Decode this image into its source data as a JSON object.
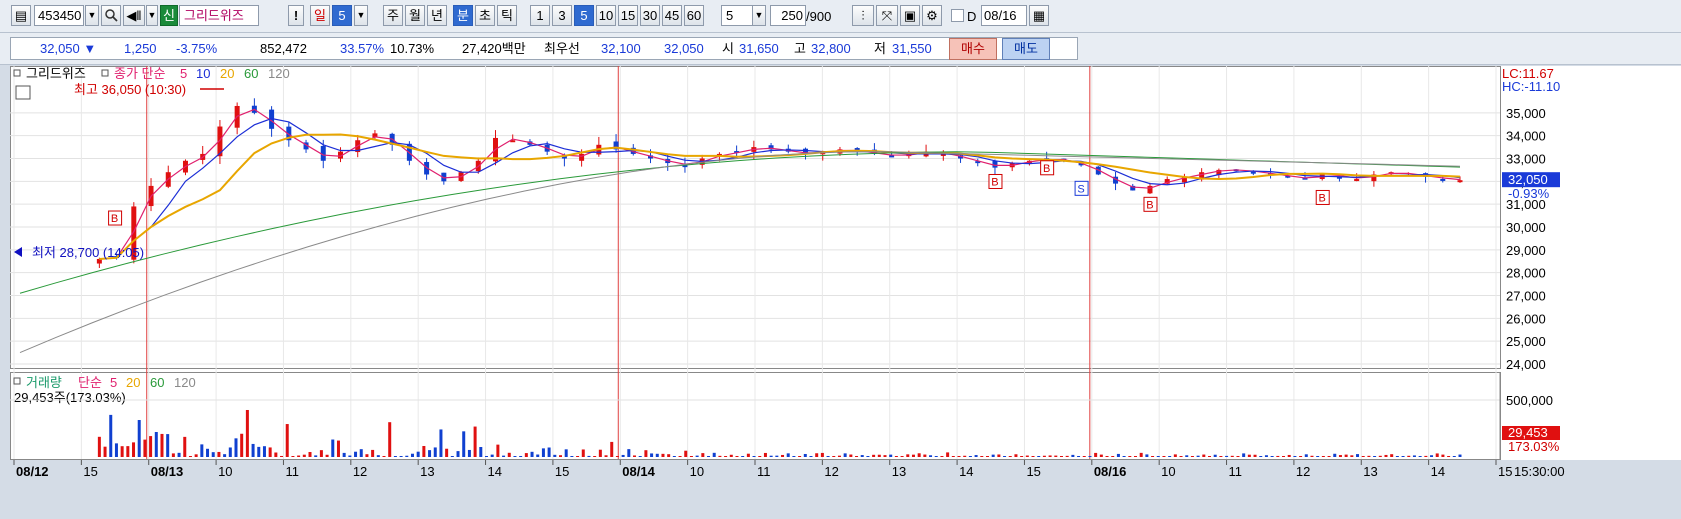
{
  "toolbar": {
    "code": "453450",
    "badge": "신",
    "name": "그리드위즈",
    "alert": "!",
    "day": "일",
    "day_value": "5",
    "week": "주",
    "month": "월",
    "year": "년",
    "minute": "분",
    "second": "초",
    "tick": "틱",
    "intervals": [
      "1",
      "3",
      "5",
      "10",
      "15",
      "30",
      "45",
      "60"
    ],
    "selected_interval": "5",
    "count": "5",
    "bars_shown": "250",
    "bars_total": "/900",
    "date_check": "D",
    "date": "08/16"
  },
  "quote": {
    "price": "32,050 ▼",
    "change": "1,250",
    "change_pct": "-3.75%",
    "volume": "852,472",
    "pct_a": "33.57%",
    "pct_b": "10.73%",
    "amount": "27,420백만",
    "best_label": "최우선",
    "best_ask": "32,100",
    "best_bid": "32,050",
    "open_label": "시",
    "open": "31,650",
    "high_label": "고",
    "high": "32,800",
    "low_label": "저",
    "low": "31,550",
    "buy_button": "매수",
    "sell_button": "매도"
  },
  "price_panel": {
    "title": "그리드위즈",
    "ma_label": "종가 단순",
    "ma_periods": [
      "5",
      "10",
      "20",
      "60",
      "120"
    ],
    "high_note": "최고 36,050 (10:30)",
    "low_note": "최저 28,700 (14:05)",
    "lc": "LC:11.67",
    "hc": "HC:-11.10",
    "y_ticks": [
      "35,000",
      "34,000",
      "33,000",
      "32,000",
      "31,000",
      "30,000",
      "29,000",
      "28,000",
      "27,000",
      "26,000",
      "25,000",
      "24,000"
    ],
    "current_price_tag": "32,050",
    "current_pct_tag": "-0.93%",
    "signals": [
      "B",
      "B",
      "B",
      "S",
      "B",
      "B"
    ]
  },
  "volume_panel": {
    "title": "거래량",
    "ma_label": "단순",
    "ma_periods": [
      "5",
      "20",
      "60",
      "120"
    ],
    "info": "29,453주(173.03%)",
    "y_tick": "500,000",
    "current_tag": "29,453",
    "current_pct": "173.03%"
  },
  "x_axis": {
    "labels": [
      "08/12",
      "15",
      "08/13",
      "10",
      "11",
      "12",
      "13",
      "14",
      "15",
      "08/14",
      "10",
      "11",
      "12",
      "13",
      "14",
      "15",
      "08/16",
      "10",
      "11",
      "12",
      "13",
      "14",
      "15"
    ],
    "time": "15:30:00"
  },
  "colors": {
    "ma5": "#e0206e",
    "ma10": "#1c2ed6",
    "ma20": "#e8a600",
    "ma60": "#2a9a3a",
    "ma120": "#8a8a8a",
    "up": "#e01010",
    "down": "#1040d0"
  },
  "chart_data": {
    "type": "candlestick",
    "approximate": true,
    "y_range": [
      24000,
      36000
    ],
    "x_sessions": [
      "08/12",
      "08/13",
      "08/14",
      "08/16"
    ],
    "close_series": [
      28600,
      28700,
      30900,
      31800,
      32400,
      32900,
      33200,
      34400,
      35300,
      35000,
      34300,
      33800,
      33400,
      32900,
      33300,
      33800,
      34100,
      33600,
      32900,
      32300,
      32000,
      32400,
      32900,
      33900,
      33800,
      33600,
      33300,
      33000,
      33200,
      33600,
      33400,
      33200,
      33000,
      32800,
      32700,
      33000,
      33200,
      33300,
      33500,
      33400,
      33300,
      33200,
      33300,
      33400,
      33300,
      33200,
      33100,
      33200,
      33300,
      33200,
      33000,
      32800,
      32600,
      32800,
      32900,
      33000,
      32900,
      32700,
      32300,
      31900,
      31600,
      31800,
      32100,
      32200,
      32400,
      32500,
      32500,
      32400,
      32300,
      32200,
      32100,
      32300,
      32200,
      32100,
      32300,
      32400,
      32300,
      32200,
      32100,
      32050
    ]
  }
}
